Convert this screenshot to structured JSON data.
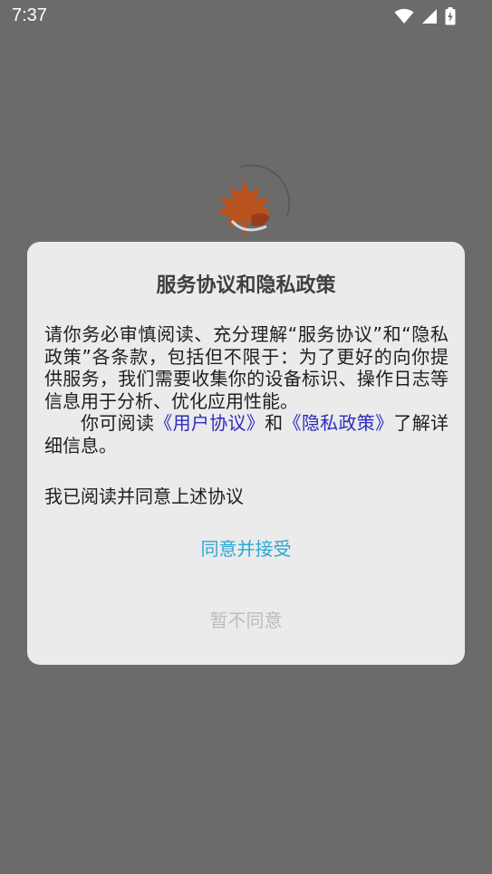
{
  "status_bar": {
    "time": "7:37",
    "icons": [
      "wifi-icon",
      "signal-icon",
      "battery-charging-icon"
    ]
  },
  "splash": {
    "logo_icon": "maple-leaf-logo-icon",
    "logo_color": "#b9521f"
  },
  "dialog": {
    "title": "服务协议和隐私政策",
    "body_paragraph_1": "请你务必审慎阅读、充分理解“服务协议”和“隐私政策”各条款，包括但不限于：为了更好的向你提供服务，我们需要收集你的设备标识、操作日志等信息用于分析、优化应用性能。",
    "body_paragraph_2_prefix": "你可阅读",
    "user_agreement_link": "《用户协议》",
    "body_paragraph_2_middle": "和",
    "privacy_policy_link": "《隐私政策》",
    "body_paragraph_2_suffix": "了解详细信息。",
    "confirm_text": "我已阅读并同意上述协议",
    "agree_button": "同意并接受",
    "decline_button": "暂不同意"
  },
  "colors": {
    "overlay": "#6b6b6b",
    "dialog_background": "#ebebeb",
    "link": "#2c2cc0",
    "agree_accent": "#2aa7d6",
    "decline_muted": "#bdbdbd"
  }
}
